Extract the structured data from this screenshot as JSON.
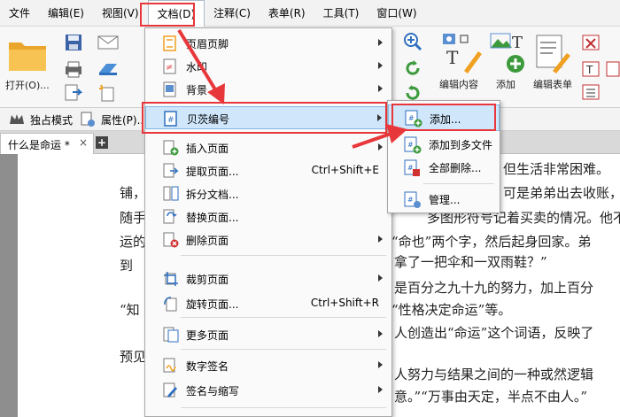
{
  "menubar": {
    "items": [
      "文件",
      "编辑(E)",
      "视图(V)",
      "文档(D)",
      "注释(C)",
      "表单(R)",
      "工具(T)",
      "窗口(W)"
    ]
  },
  "ribbon": {
    "open_label": "打开(O)...",
    "edit_content_label": "编辑内容",
    "add_label": "添加",
    "edit_form_label": "编辑表单"
  },
  "toolbar2": {
    "exclusive_mode": "独占模式",
    "properties": "属性(P)..."
  },
  "tabs": {
    "doc_tab_label": "什么是命运 *",
    "close": "×",
    "plus": "+"
  },
  "document": {
    "lines": [
      "但生活非常困难。",
      "铺，",
      "可是弟弟出去收账，",
      "随手",
      "多图形符号记着买卖的情况。他不",
      "运的",
      "“命也”两个字，然后起身回家。弟",
      "到",
      "拿了一把伞和一双雨鞋？”",
      "是百分之九十九的努力，加上百分",
      "“知",
      "“性格决定命运”等。",
      "人创造出“命运”这个词语，反映了",
      "预见",
      "人努力与结果之间的一种或然逻辑",
      "意。”“万事由天定，半点不由人。”"
    ]
  },
  "doc_menu": {
    "items": [
      {
        "label": "页眉页脚",
        "shortcut": ""
      },
      {
        "label": "水印",
        "shortcut": ""
      },
      {
        "label": "背景",
        "shortcut": ""
      },
      {
        "label": "贝茨编号",
        "shortcut": ""
      },
      {
        "label": "插入页面",
        "shortcut": ""
      },
      {
        "label": "提取页面...",
        "shortcut": "Ctrl+Shift+E"
      },
      {
        "label": "拆分文档...",
        "shortcut": ""
      },
      {
        "label": "替换页面...",
        "shortcut": ""
      },
      {
        "label": "删除页面",
        "shortcut": ""
      },
      {
        "label": "裁剪页面",
        "shortcut": ""
      },
      {
        "label": "旋转页面...",
        "shortcut": "Ctrl+Shift+R"
      },
      {
        "label": "更多页面",
        "shortcut": ""
      },
      {
        "label": "数字签名",
        "shortcut": ""
      },
      {
        "label": "签名与缩写",
        "shortcut": ""
      }
    ]
  },
  "bates_menu": {
    "items": [
      "添加...",
      "添加到多文件",
      "全部删除...",
      "管理..."
    ]
  },
  "colors": {
    "highlight": "#cfe6fb",
    "annotation_red": "#e8373a",
    "accent_blue": "#2f6fbf",
    "accent_green": "#3c9a3c",
    "folder_yellow": "#f4b63c"
  }
}
